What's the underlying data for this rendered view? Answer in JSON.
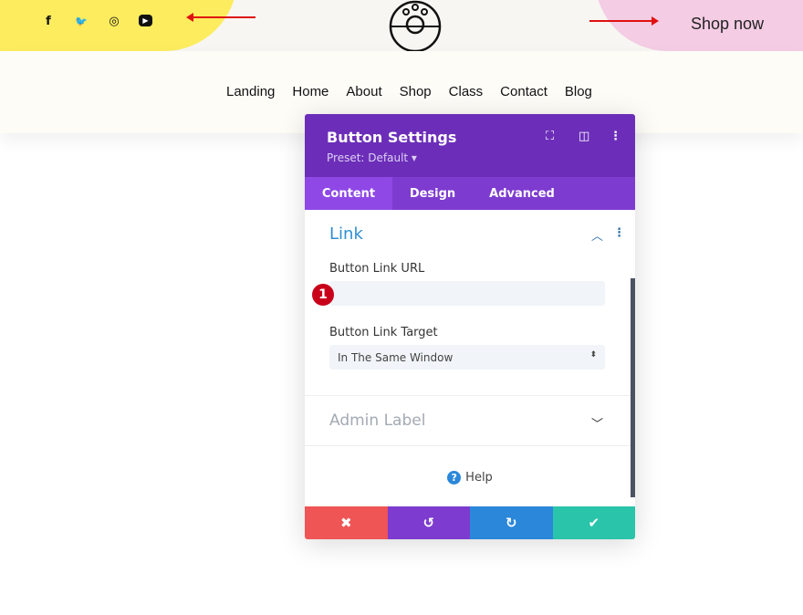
{
  "header": {
    "social": [
      {
        "icon": "facebook-icon",
        "glyph": "f"
      },
      {
        "icon": "twitter-icon",
        "glyph": "🐦"
      },
      {
        "icon": "instagram-icon",
        "glyph": "◎"
      },
      {
        "icon": "youtube-icon",
        "glyph": "▶"
      }
    ],
    "shop_label": "Shop now"
  },
  "nav": {
    "items": [
      "Landing",
      "Home",
      "About",
      "Shop",
      "Class",
      "Contact",
      "Blog"
    ]
  },
  "modal": {
    "title": "Button Settings",
    "preset": "Preset: Default ▾",
    "tabs": [
      "Content",
      "Design",
      "Advanced"
    ],
    "section": "Link",
    "url_label": "Button Link URL",
    "url_value": "",
    "badge": "1",
    "target_label": "Button Link Target",
    "target_value": "In The Same Window",
    "admin_label": "Admin Label",
    "help": "Help"
  },
  "colors": {
    "header": "#6c2eb9",
    "cancel": "#ef5555",
    "undo": "#7d3bcf",
    "redo": "#2b87da",
    "save": "#29c4a9"
  }
}
